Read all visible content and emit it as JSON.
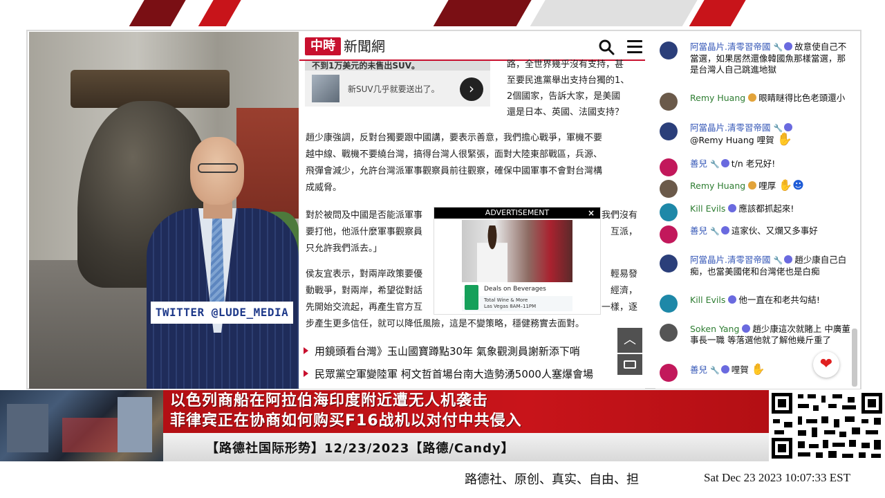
{
  "video": {
    "twitter_label": "TWITTER  @LUDE_MEDIA"
  },
  "article": {
    "logo_mark": "中時",
    "logo_text": "新聞網",
    "promo_head": "不到1万美元的未售出SUV。",
    "promo_text": "新SUV几乎就要送出了。",
    "side_lines": [
      "路，全世界幾乎沒有支持，甚",
      "至要民進黨舉出支持台獨的1、",
      "2個國家，告訴大家，是美國",
      "還是日本、英國、法國支持？"
    ],
    "para1": [
      "趙少康強調，反對台獨要跟中國講，要表示善意，我們擔心戰爭，軍機不要",
      "越中線、戰機不要繞台灣，搞得台灣人很緊張，面對大陸東部戰區，兵源、",
      "飛彈會減少，允許台灣派軍事觀察員前往觀察，確保中國軍事不會對台灣構",
      "成威脅。"
    ],
    "para2": [
      "對於被問及中國是否能派軍事",
      "我們沒有",
      "要打他，他派什麼軍事觀察員",
      "互派，",
      "只允許我們派去。」"
    ],
    "para3": [
      "侯友宜表示，對兩岸政策要優",
      "輕易發",
      "動戰爭，對兩岸，希望從對話",
      "經濟，",
      "先開始交流起，再產生官方互",
      "一樣，逐",
      "步產生更多信任，就可以降低風險，這是不變策略，穩健務實去面對。"
    ],
    "bullets": [
      "用鏡頭看台灣》玉山國寶蹲點30年 氣象觀測員謝新添下哨",
      "民眾黨空軍變陸軍 柯文哲首場台南大造勢湧5000人塞爆會場"
    ]
  },
  "ad": {
    "label": "ADVERTISEMENT",
    "close": "×",
    "title": "Deals on Beverages",
    "line1": "Total Wine & More",
    "line2": "Las Vegas 8AM–11PM"
  },
  "chat": {
    "messages": [
      {
        "author": "阿當晶片.清零習帝國",
        "text": "故意使自己不當選，如果居然還像韓國魚那樣當選，那是台灣人自己跳進地獄",
        "avatar_color": "#2b3f7a"
      },
      {
        "author": "Remy Huang",
        "text": "眼睛瞇得比色老頭還小",
        "avatar_color": "#6b5a4a"
      },
      {
        "author": "阿當晶片.清零習帝國",
        "text": "@Remy Huang 哩賀",
        "avatar_color": "#2b3f7a"
      },
      {
        "author": "善兒",
        "text": "t/n 老兄好!",
        "avatar_color": "#c2185b"
      },
      {
        "author": "Remy Huang",
        "text": "哩厚",
        "avatar_color": "#6b5a4a"
      },
      {
        "author": "Kill Evils",
        "text": "應該都抓起來!",
        "avatar_color": "#1e88a8"
      },
      {
        "author": "善兒",
        "text": "這家伙、又爛又多事好",
        "avatar_color": "#c2185b"
      },
      {
        "author": "阿當晶片.清零習帝國",
        "text": "趙少康自己白痴，也當美國佬和台灣佬也是白痴",
        "avatar_color": "#2b3f7a"
      },
      {
        "author": "Kill Evils",
        "text": "他一直在和老共勾結!",
        "avatar_color": "#1e88a8"
      },
      {
        "author": "Soken Yang",
        "text": "趙少康這次就賭上 中廣董事長一職 等落選他就了解他幾斤重了",
        "avatar_color": "#555555"
      },
      {
        "author": "善兒",
        "text": "哩賀",
        "avatar_color": "#c2185b"
      }
    ]
  },
  "ticker": {
    "headline1": "以色列商船在阿拉伯海印度附近遭无人机袭击",
    "headline2": "菲律宾正在协商如何购买F16战机以对付中共侵入",
    "program": "【路德社国际形势】12/23/2023【路德/Candy】",
    "slogan": "路德社、原创、真实、自由、担",
    "clock": "Sat Dec 23 2023 10:07:33 EST"
  },
  "colors": {
    "brand_red": "#c8102e",
    "banner_red": "#c8141a",
    "chat_author_green": "#2e7d32",
    "chat_author_blue": "#3557b7"
  }
}
